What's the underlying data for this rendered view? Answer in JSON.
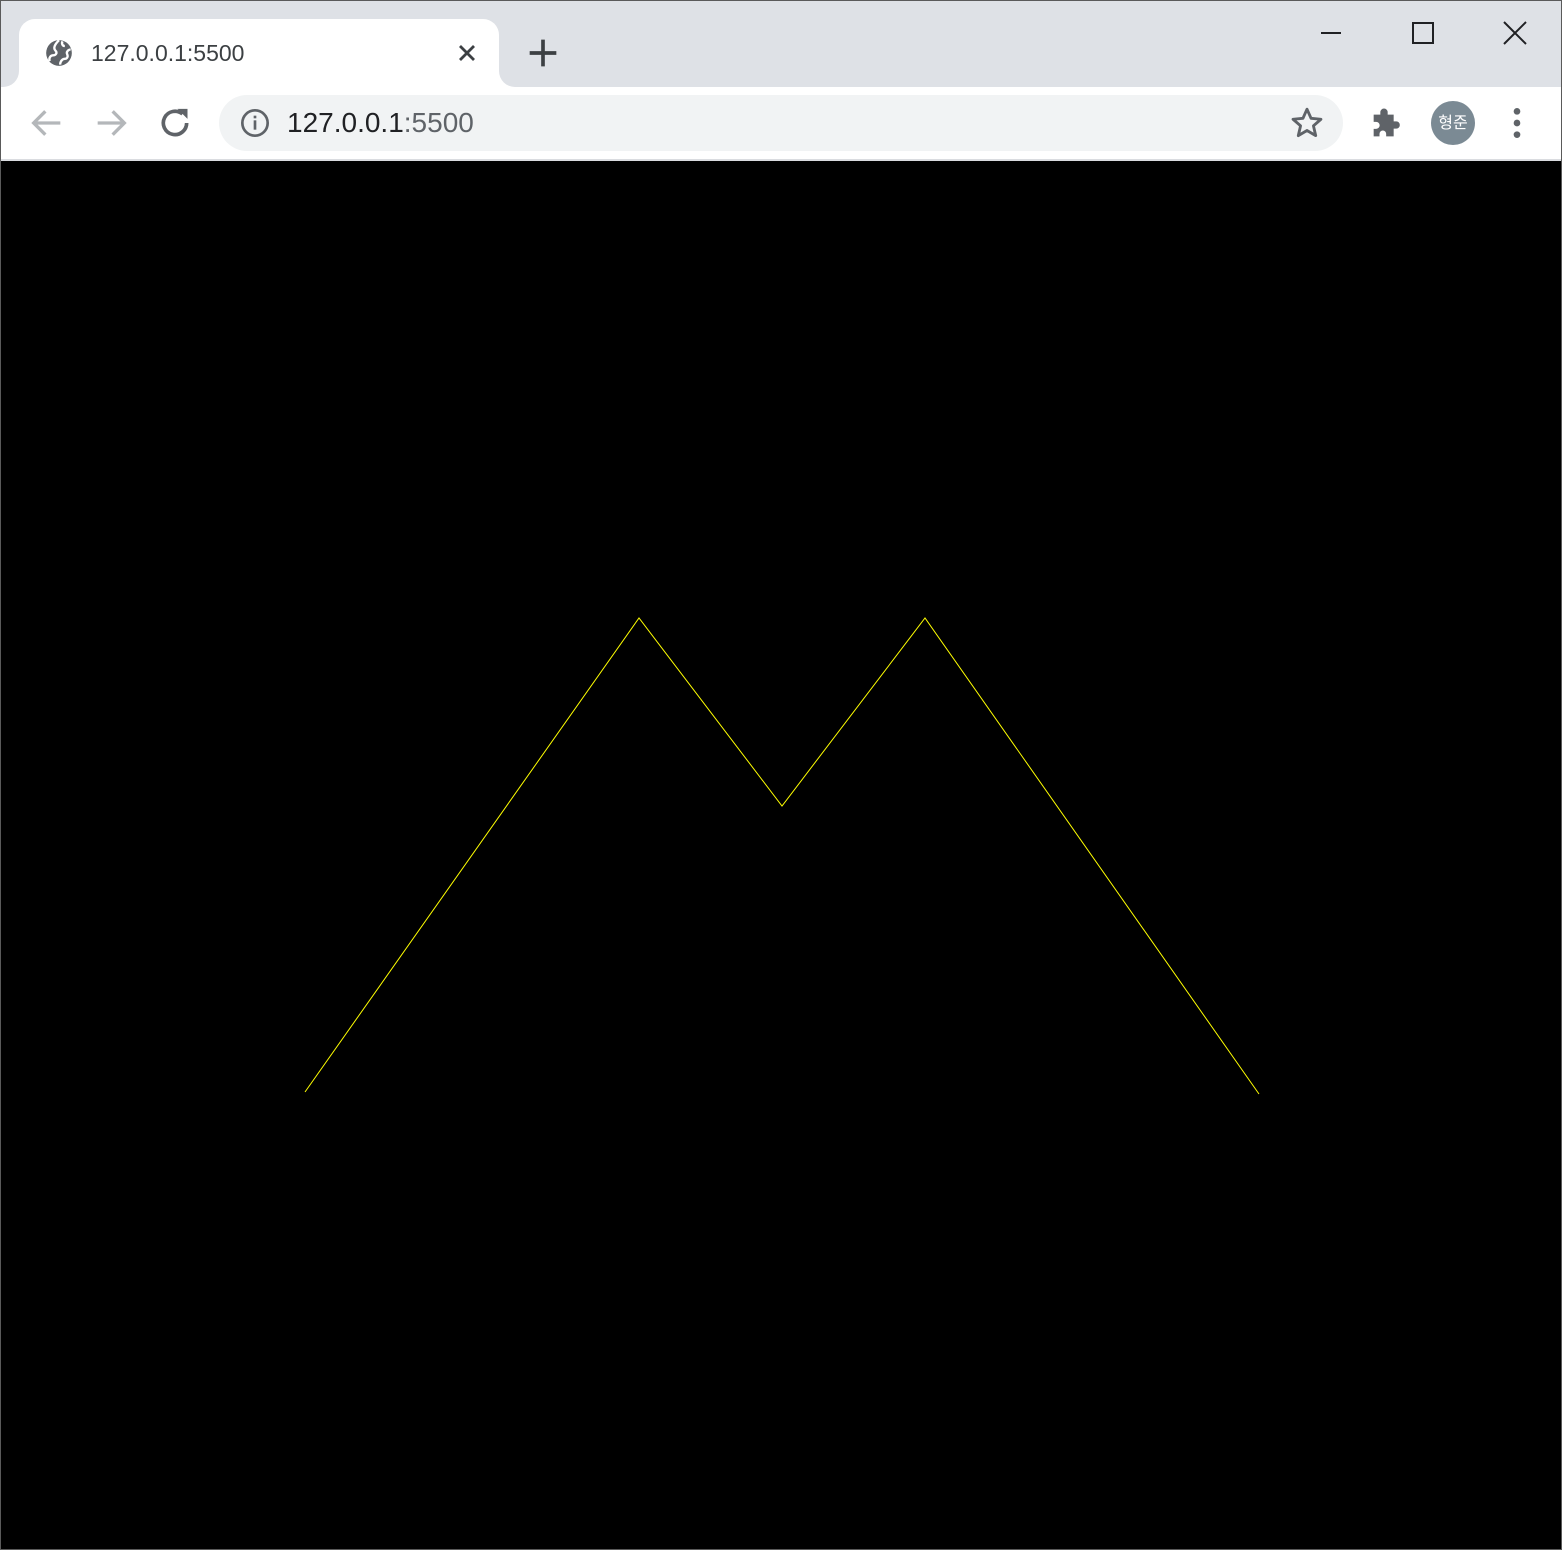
{
  "window": {
    "controls": {
      "minimize_icon": "minimize-icon",
      "maximize_icon": "maximize-icon",
      "close_icon": "close-icon"
    }
  },
  "tab": {
    "title": "127.0.0.1:5500",
    "favicon": "globe-icon",
    "close_icon": "close-icon"
  },
  "new_tab_icon": "plus-icon",
  "toolbar": {
    "back_icon": "arrow-left-icon",
    "forward_icon": "arrow-right-icon",
    "reload_icon": "reload-icon",
    "omnibox": {
      "site_info_icon": "info-icon",
      "url_host": "127.0.0.1",
      "url_port": ":5500",
      "bookmark_icon": "star-icon"
    },
    "extensions_icon": "puzzle-icon",
    "profile_avatar_text": "형준",
    "menu_icon": "kebab-menu-icon"
  },
  "page": {
    "background": "#000000",
    "drawing": {
      "stroke_color": "#ffff00",
      "shape": "mountain-polyline"
    }
  }
}
